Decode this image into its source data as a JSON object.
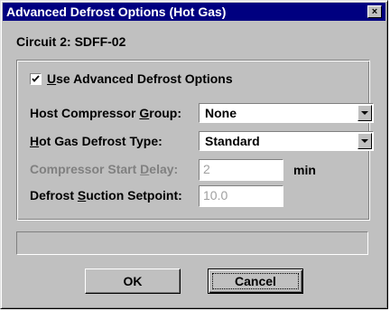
{
  "window": {
    "title": "Advanced Defrost Options (Hot Gas)",
    "close_glyph": "×",
    "close_icon": "close-icon"
  },
  "circuit_label": "Circuit 2: SDFF-02",
  "advanced": {
    "checkbox_checked": true,
    "checkbox_label_mnemonic": "U",
    "checkbox_label_rest": "se Advanced Defrost Options"
  },
  "fields": {
    "host_compressor_group": {
      "label_pre": "Host Compressor ",
      "label_mnemonic": "G",
      "label_post": "roup:",
      "value": "None"
    },
    "hot_gas_defrost_type": {
      "label_pre": "",
      "label_mnemonic": "H",
      "label_post": "ot Gas Defrost Type:",
      "value": "Standard"
    },
    "compressor_start_delay": {
      "label_pre": "Compressor Start ",
      "label_mnemonic": "D",
      "label_post": "elay:",
      "value": "2",
      "unit": "min"
    },
    "defrost_suction_setpoint": {
      "label_pre": "Defrost ",
      "label_mnemonic": "S",
      "label_post": "uction Setpoint:",
      "value": "10.0"
    }
  },
  "status_text": "",
  "buttons": {
    "ok_label": "OK",
    "cancel_label": "Cancel"
  }
}
